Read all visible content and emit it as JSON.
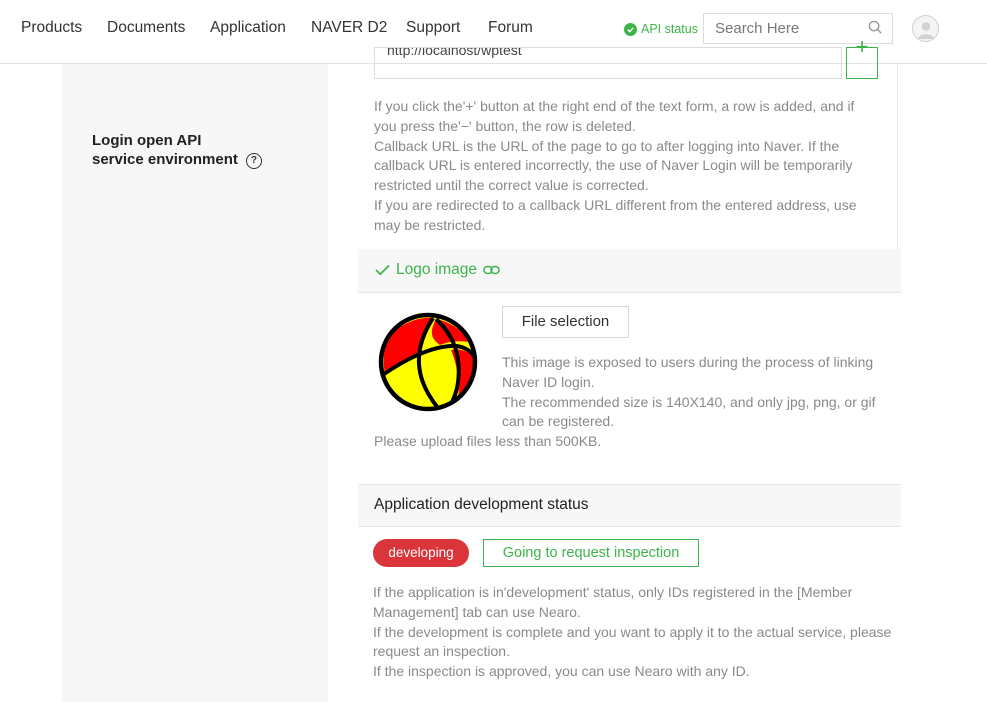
{
  "nav": {
    "items": [
      "Products",
      "Documents",
      "Application",
      "NAVER D2",
      "Support",
      "Forum"
    ],
    "api_status": "API status",
    "search_placeholder": "Search Here",
    "icons": {
      "search": "search-icon",
      "avatar": "user-avatar-icon",
      "api_status": "check-circle-icon"
    }
  },
  "section": {
    "label_line1": "Login open API",
    "label_line2": "service environment",
    "help_icon": "?"
  },
  "callback": {
    "value": "http://localhost/wptest",
    "add_button": "+",
    "help": [
      "If you click the'+' button at the right end of the text form, a row is added, and if you press the'−' button, the row is deleted.",
      "Callback URL is the URL of the page to go to after logging into Naver. If the callback URL is entered incorrectly, the use of Naver Login will be temporarily restricted until the correct value is corrected.",
      "If you are redirected to a callback URL different from the entered address, use may be restricted."
    ]
  },
  "logo": {
    "title": "Logo image",
    "file_button": "File selection",
    "help_line1": "This image is exposed to users during the process of linking Naver ID login.",
    "help_line2": "The recommended size is 140X140, and only jpg, png, or gif can be registered.",
    "size_note": "Please upload files less than 500KB.",
    "colors": {
      "red": "#ff0000",
      "yellow": "#ffff00",
      "outline": "#000000"
    }
  },
  "status": {
    "title": "Application development status",
    "badge": "developing",
    "inspect_button": "Going to request inspection",
    "help": [
      "If the application is in'development' status, only IDs registered in the [Member Management] tab can use Nearo.",
      "If the development is complete and you want to apply it to the actual service, please request an inspection.",
      "If the inspection is approved, you can use Nearo with any ID."
    ]
  },
  "colors": {
    "accent": "#3cb44a",
    "badge": "#d9353a",
    "muted_text": "#8a8a8a"
  }
}
